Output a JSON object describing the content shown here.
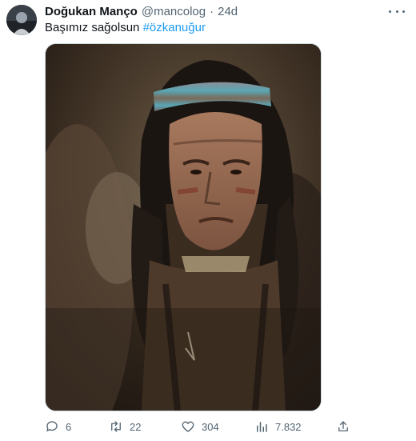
{
  "tweet": {
    "author_name": "Doğukan Manço",
    "handle": "@mancolog",
    "separator": "·",
    "time": "24d",
    "text": "Başımız sağolsun",
    "hashtag": "#özkanuğur"
  },
  "actions": {
    "replies": "6",
    "retweets": "22",
    "likes": "304",
    "views": "7.832"
  },
  "colors": {
    "accent": "#1d9bf0",
    "muted": "#536471"
  },
  "icons": [
    "more-icon",
    "reply-icon",
    "retweet-icon",
    "like-icon",
    "views-icon",
    "share-icon"
  ]
}
